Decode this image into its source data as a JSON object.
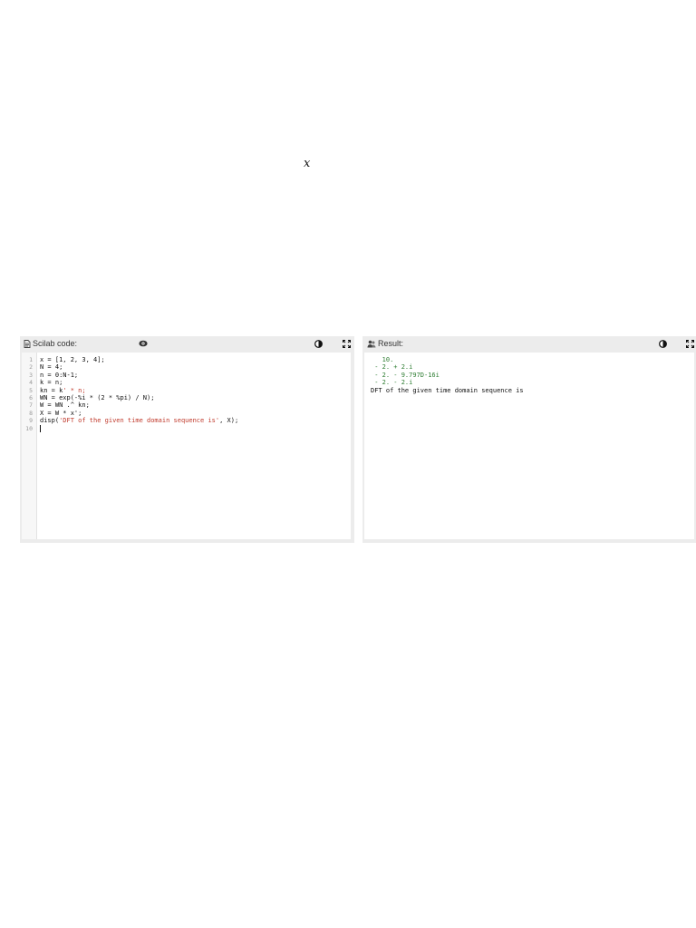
{
  "page": {
    "math_symbol": "x"
  },
  "code_panel": {
    "title": "Scilab code:",
    "icons": [
      "file-icon",
      "eye-icon",
      "contrast-icon",
      "fullscreen-icon"
    ],
    "line_numbers": [
      "1",
      "2",
      "3",
      "4",
      "5",
      "6",
      "7",
      "8",
      "9",
      "10"
    ],
    "lines": [
      "x = [1, 2, 3, 4];",
      "N = 4;",
      "n = 0:N-1;",
      "k = n;",
      "kn = k' * n;",
      "WN = exp(-%i * (2 * %pi) / N);",
      "W = WN .^ kn;",
      "X = W * x';",
      "disp(",
      ""
    ],
    "line9_string": "'DFT of the given time domain sequence is'",
    "line9_tail": ", X);",
    "line5_prefix": "kn = k",
    "line5_string": "' * n;"
  },
  "result_panel": {
    "title": "Result:",
    "icons": [
      "users-icon",
      "contrast-icon",
      "fullscreen-icon"
    ],
    "output": [
      {
        "text": "   10.",
        "kind": "num"
      },
      {
        "text": " - 2. + 2.i",
        "kind": "num"
      },
      {
        "text": " - 2. - 9.797D-16i",
        "kind": "num"
      },
      {
        "text": " - 2. - 2.i",
        "kind": "num"
      },
      {
        "text": "DFT of the given time domain sequence is",
        "kind": "plain"
      }
    ]
  },
  "colors": {
    "panel_bg": "#ececec",
    "string": "#c0392b",
    "number_output": "#2e7d32"
  }
}
